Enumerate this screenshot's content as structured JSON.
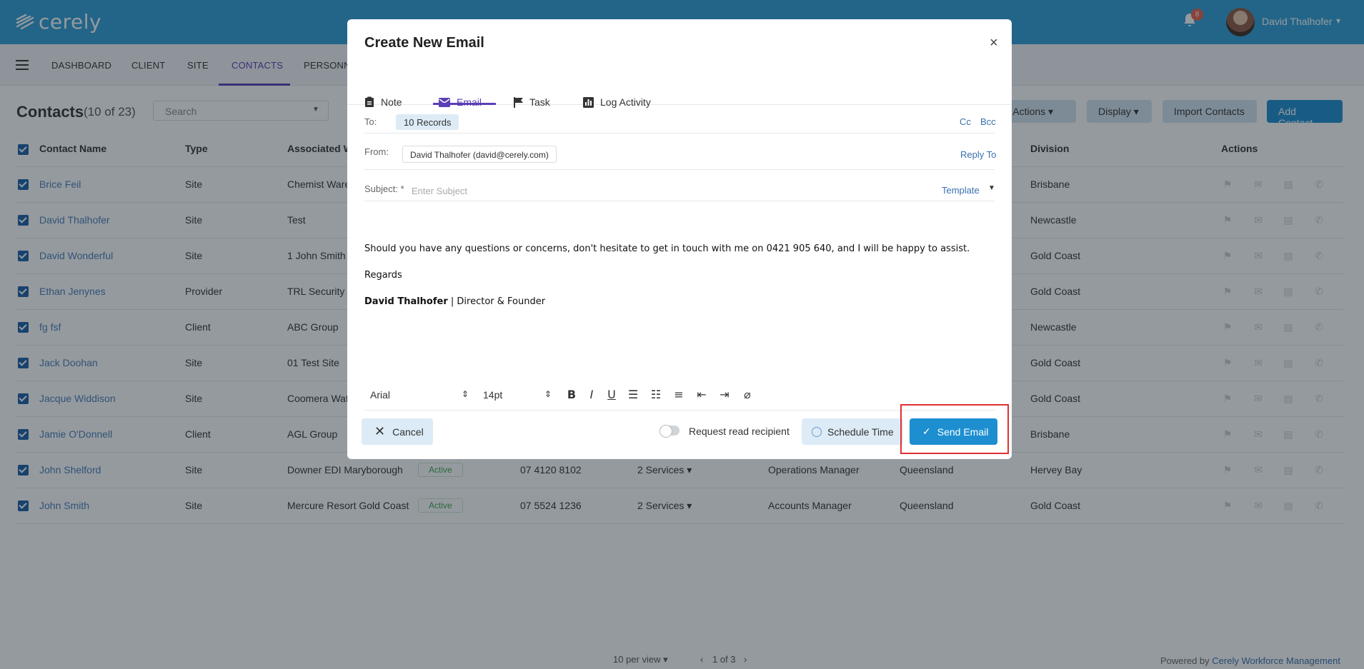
{
  "header": {
    "logo_text": "cerely",
    "notification_count": "8",
    "user_name": "David Thalhofer"
  },
  "nav": {
    "items": [
      "DASHBOARD",
      "CLIENT",
      "SITE",
      "CONTACTS",
      "PERSONNEL"
    ],
    "active": "CONTACTS"
  },
  "toolbar": {
    "title": "Contacts",
    "count": "(10 of 23)",
    "search_placeholder": "Search",
    "bulk_actions": "lk Actions",
    "display": "Display",
    "import": "Import Contacts",
    "add": "Add Contact"
  },
  "table": {
    "headers": {
      "contact_name": "Contact Name",
      "type": "Type",
      "associated": "Associated W",
      "division": "Division",
      "actions": "Actions"
    },
    "rows": [
      {
        "name": "Brice Feil",
        "type": "Site",
        "assoc": "Chemist Ware",
        "status": "",
        "phone": "",
        "services": "",
        "role": "",
        "state": "",
        "division": "Brisbane"
      },
      {
        "name": "David Thalhofer",
        "type": "Site",
        "assoc": "Test",
        "status": "",
        "phone": "",
        "services": "",
        "role": "",
        "state": "",
        "division": "Newcastle"
      },
      {
        "name": "David Wonderful",
        "type": "Site",
        "assoc": "1 John Smith",
        "status": "",
        "phone": "",
        "services": "",
        "role": "",
        "state": "",
        "division": "Gold Coast"
      },
      {
        "name": "Ethan Jenynes",
        "type": "Provider",
        "assoc": "TRL Security",
        "status": "",
        "phone": "",
        "services": "",
        "role": "",
        "state": "",
        "division": "Gold Coast"
      },
      {
        "name": "fg fsf",
        "type": "Client",
        "assoc": "ABC Group",
        "status": "",
        "phone": "",
        "services": "",
        "role": "",
        "state": "",
        "division": "Newcastle"
      },
      {
        "name": "Jack Doohan",
        "type": "Site",
        "assoc": "01 Test Site",
        "status": "",
        "phone": "",
        "services": "",
        "role": "",
        "state": "",
        "division": "Gold Coast"
      },
      {
        "name": "Jacque Widdison",
        "type": "Site",
        "assoc": "Coomera Wat",
        "status": "",
        "phone": "",
        "services": "",
        "role": "",
        "state": "",
        "division": "Gold Coast"
      },
      {
        "name": "Jamie O'Donnell",
        "type": "Client",
        "assoc": "AGL Group",
        "status": "",
        "phone": "",
        "services": "",
        "role": "",
        "state": "",
        "division": "Brisbane"
      },
      {
        "name": "John Shelford",
        "type": "Site",
        "assoc": "Downer EDI Maryborough",
        "status": "Active",
        "phone": "07 4120 8102",
        "services": "2 Services ▾",
        "role": "Operations Manager",
        "state": "Queensland",
        "division": "Hervey Bay"
      },
      {
        "name": "John Smith",
        "type": "Site",
        "assoc": "Mercure Resort Gold Coast",
        "status": "Active",
        "phone": "07 5524 1236",
        "services": "2 Services ▾",
        "role": "Accounts Manager",
        "state": "Queensland",
        "division": "Gold Coast"
      }
    ]
  },
  "modal": {
    "title": "Create New Email",
    "tabs": {
      "note": "Note",
      "email": "Email",
      "task": "Task",
      "log": "Log Activity"
    },
    "to_label": "To:",
    "to_chip": "10 Records",
    "cc": "Cc",
    "bcc": "Bcc",
    "from_label": "From:",
    "from_value": "David Thalhofer (david@cerely.com)",
    "reply_to": "Reply To",
    "subject_label": "Subject: *",
    "subject_placeholder": "Enter Subject",
    "template": "Template",
    "body_line1": "Should you have any questions or concerns, don't hesitate to get in touch with me on 0421 905 640, and I will be happy to assist.",
    "body_line2": "Regards",
    "sig_name": "David Thalhofer",
    "sig_role": " | Director & Founder",
    "font": "Arial",
    "size": "14pt",
    "cancel": "Cancel",
    "read_receipt": "Request read recipient",
    "schedule": "Schedule Time",
    "send": "Send Email"
  },
  "footer": {
    "per_view": "10 per view",
    "page": "1 of 3",
    "powered_prefix": "Powered by ",
    "powered_link": "Cerely Workforce Management"
  }
}
